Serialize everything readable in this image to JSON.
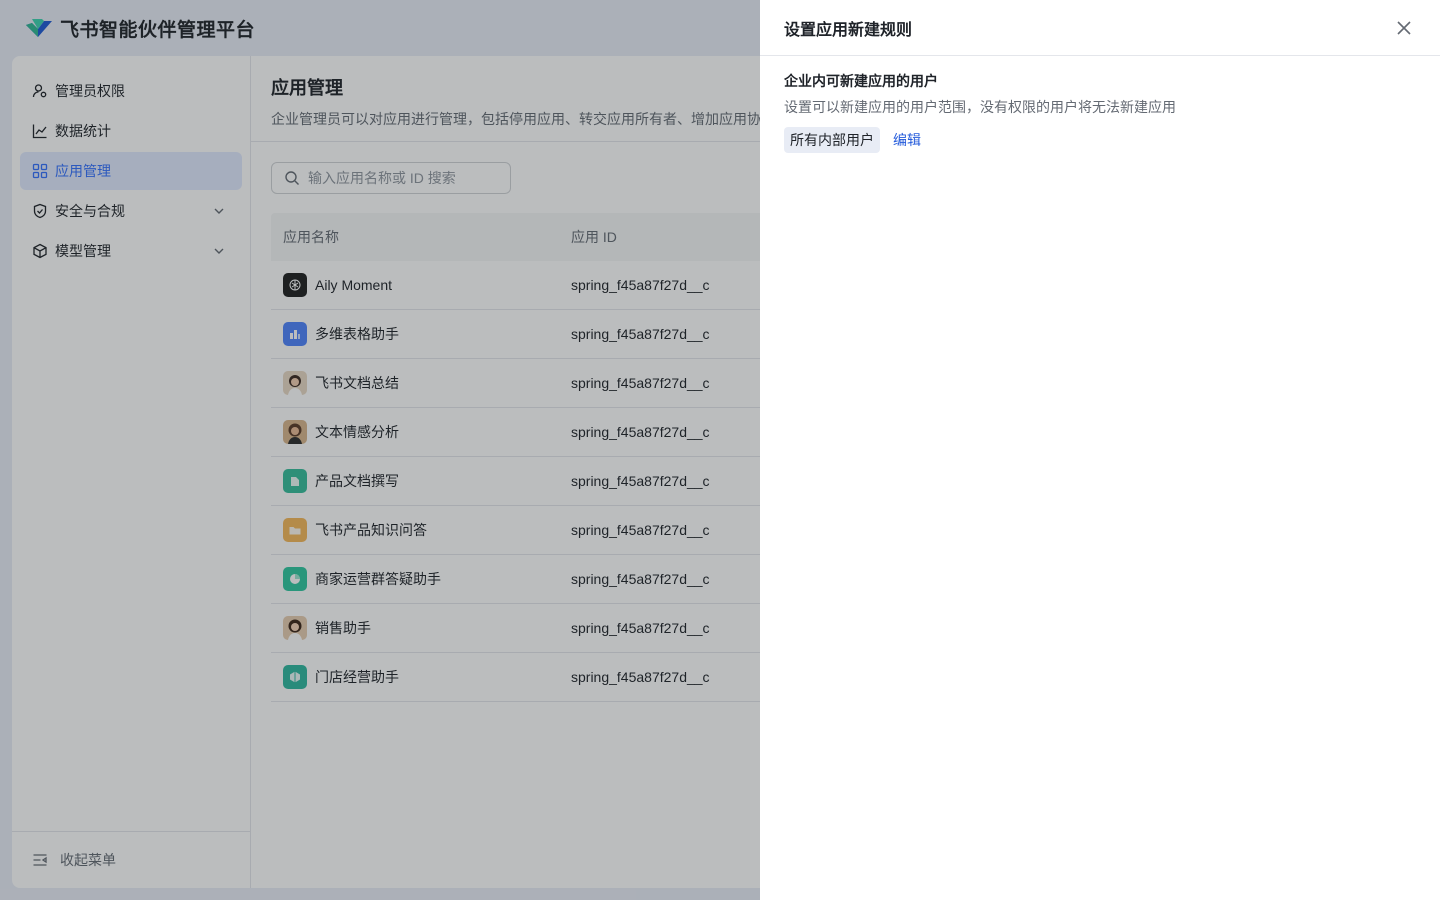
{
  "header": {
    "brand": "飞书智能伙伴管理平台",
    "logo_icon": "feishu-logo-icon"
  },
  "sidebar": {
    "items": [
      {
        "label": "管理员权限",
        "icon": "admin-user-icon"
      },
      {
        "label": "数据统计",
        "icon": "line-chart-icon"
      },
      {
        "label": "应用管理",
        "icon": "app-grid-icon",
        "active": true
      },
      {
        "label": "安全与合规",
        "icon": "shield-icon",
        "expandable": true
      },
      {
        "label": "模型管理",
        "icon": "cube-icon",
        "expandable": true
      }
    ],
    "collapse_label": "收起菜单"
  },
  "main": {
    "title": "应用管理",
    "description": "企业管理员可以对应用进行管理，包括停用应用、转交应用所有者、增加应用协",
    "search_placeholder": "输入应用名称或 ID 搜索",
    "table": {
      "headers": [
        "应用名称",
        "应用 ID"
      ],
      "rows": [
        {
          "name": "Aily Moment",
          "id": "spring_f45a87f27d__c",
          "icon_color": "#1f1f1f"
        },
        {
          "name": "多维表格助手",
          "id": "spring_f45a87f27d__c",
          "icon_color": "#4e83fd"
        },
        {
          "name": "飞书文档总结",
          "id": "spring_f45a87f27d__c",
          "icon_color": "#e9d8c4"
        },
        {
          "name": "文本情感分析",
          "id": "spring_f45a87f27d__c",
          "icon_color": "#d9b58c"
        },
        {
          "name": "产品文档撰写",
          "id": "spring_f45a87f27d__c",
          "icon_color": "#35bd9b"
        },
        {
          "name": "飞书产品知识问答",
          "id": "spring_f45a87f27d__c",
          "icon_color": "#f5b85a"
        },
        {
          "name": "商家运营群答疑助手",
          "id": "spring_f45a87f27d__c",
          "icon_color": "#2ec7a0"
        },
        {
          "name": "销售助手",
          "id": "spring_f45a87f27d__c",
          "icon_color": "#e7cdb0"
        },
        {
          "name": "门店经营助手",
          "id": "spring_f45a87f27d__c",
          "icon_color": "#2fb8a0"
        }
      ]
    }
  },
  "drawer": {
    "title": "设置应用新建规则",
    "section_title": "企业内可新建应用的用户",
    "section_desc": "设置可以新建应用的用户范围，没有权限的用户将无法新建应用",
    "scope_tag": "所有内部用户",
    "edit_label": "编辑",
    "close_icon": "close-icon"
  },
  "colors": {
    "accent": "#3370ff",
    "link": "#245bdb",
    "text": "#1f2329",
    "subtext": "#646a73"
  }
}
